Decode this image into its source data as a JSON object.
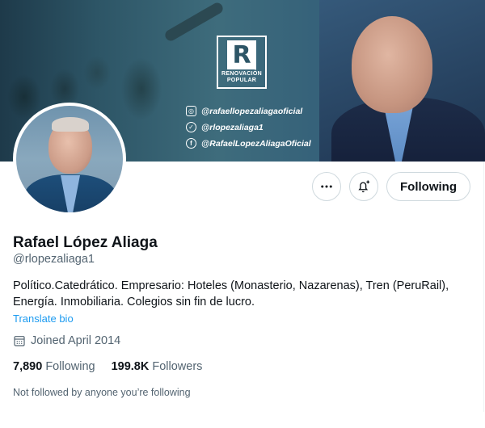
{
  "banner": {
    "logo_letter": "R",
    "logo_text_line1": "RENOVACIÓN",
    "logo_text_line2": "POPULAR",
    "socials": [
      {
        "icon": "instagram-icon",
        "handle": "@rafaellopezaliagaoficial"
      },
      {
        "icon": "twitter-icon",
        "handle": "@rlopezaliaga1"
      },
      {
        "icon": "facebook-icon",
        "handle": "@RafaelLopezAliagaOficial"
      }
    ]
  },
  "actions": {
    "more_icon": "more-icon",
    "notify_icon": "bell-plus-icon",
    "follow_label": "Following"
  },
  "profile": {
    "name": "Rafael López Aliaga",
    "handle": "@rlopezaliaga1",
    "bio": "Político.Catedrático. Empresario: Hoteles (Monasterio, Nazarenas), Tren (PeruRail), Energía. Inmobiliaria. Colegios sin fin de lucro.",
    "translate_label": "Translate bio",
    "joined": "Joined April 2014",
    "following_count": "7,890",
    "following_label": "Following",
    "followers_count": "199.8K",
    "followers_label": "Followers",
    "not_followed_text": "Not followed by anyone you’re following"
  },
  "colors": {
    "link": "#1d9bf0",
    "secondary_text": "#536471",
    "border": "#cfd9de"
  }
}
